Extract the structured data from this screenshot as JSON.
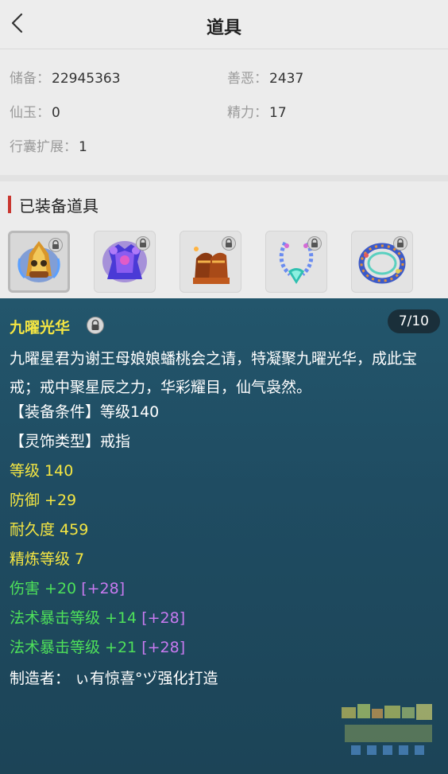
{
  "header": {
    "title": "道具"
  },
  "stats": {
    "savings_label": "储备：",
    "savings_value": "22945363",
    "karma_label": "善恶：",
    "karma_value": "2437",
    "jade_label": "仙玉：",
    "jade_value": "0",
    "energy_label": "精力：",
    "energy_value": "17",
    "bag_label": "行囊扩展：",
    "bag_value": "1"
  },
  "equipped": {
    "title": "已装备道具",
    "items": [
      {
        "name": "helmet-item"
      },
      {
        "name": "armor-item"
      },
      {
        "name": "boots-item"
      },
      {
        "name": "necklace-item"
      },
      {
        "name": "ring-item"
      }
    ]
  },
  "detail": {
    "name": "九曜光华",
    "page": "7/10",
    "description": "九曜星君为谢王母娘娘蟠桃会之请，特凝聚九曜光华，成此宝戒；戒中聚星辰之力，华彩耀目，仙气袅然。",
    "requirement": "【装备条件】等级140",
    "type": "【灵饰类型】戒指",
    "level": "等级 140",
    "defense": "防御 +29",
    "durability": "耐久度 459",
    "refine": "精炼等级 7",
    "damage": {
      "base": "伤害 +20",
      "bonus": "[+28]"
    },
    "crit1": {
      "base": "法术暴击等级 +14",
      "bonus": "[+28]"
    },
    "crit2": {
      "base": "法术暴击等级 +21",
      "bonus": "[+28]"
    },
    "maker": "制造者： ぃ有惊喜°ヅ强化打造"
  },
  "colors": {
    "name_yellow": "#f5e642",
    "stat_green": "#4ee05a",
    "bonus_purple": "#c87af0",
    "panel_bg": "#21506a",
    "section_bar": "#c9362f"
  },
  "icons": [
    "back-chevron-icon",
    "lock-icon"
  ]
}
